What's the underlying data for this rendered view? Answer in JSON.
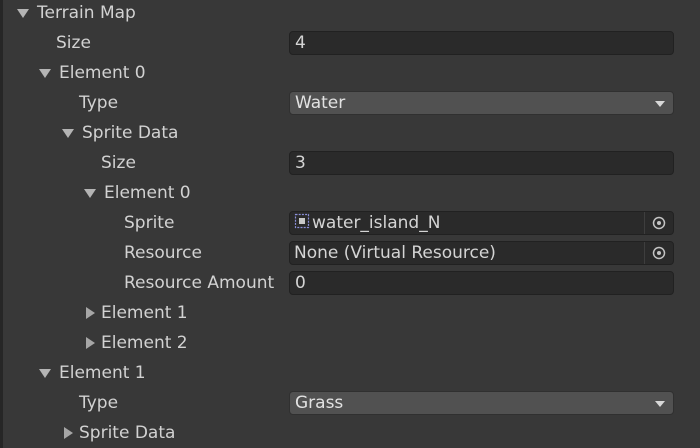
{
  "root": {
    "label": "Terrain Map",
    "size_label": "Size",
    "size_value": "4"
  },
  "element0": {
    "label": "Element 0",
    "type_label": "Type",
    "type_value": "Water",
    "sprite_data_label": "Sprite Data",
    "sprite_data": {
      "size_label": "Size",
      "size_value": "3",
      "element0": {
        "label": "Element 0",
        "sprite_label": "Sprite",
        "sprite_value": "water_island_N",
        "resource_label": "Resource",
        "resource_value": "None (Virtual Resource)",
        "resource_amount_label": "Resource Amount",
        "resource_amount_value": "0"
      },
      "element1_label": "Element 1",
      "element2_label": "Element 2"
    }
  },
  "element1": {
    "label": "Element 1",
    "type_label": "Type",
    "type_value": "Grass",
    "sprite_data_label": "Sprite Data"
  },
  "icons": {
    "foldout_open": "triangle-down-icon",
    "foldout_closed": "triangle-right-icon",
    "dropdown": "dropdown-arrow-icon",
    "object_picker": "object-picker-icon",
    "sprite": "sprite-asset-icon"
  }
}
